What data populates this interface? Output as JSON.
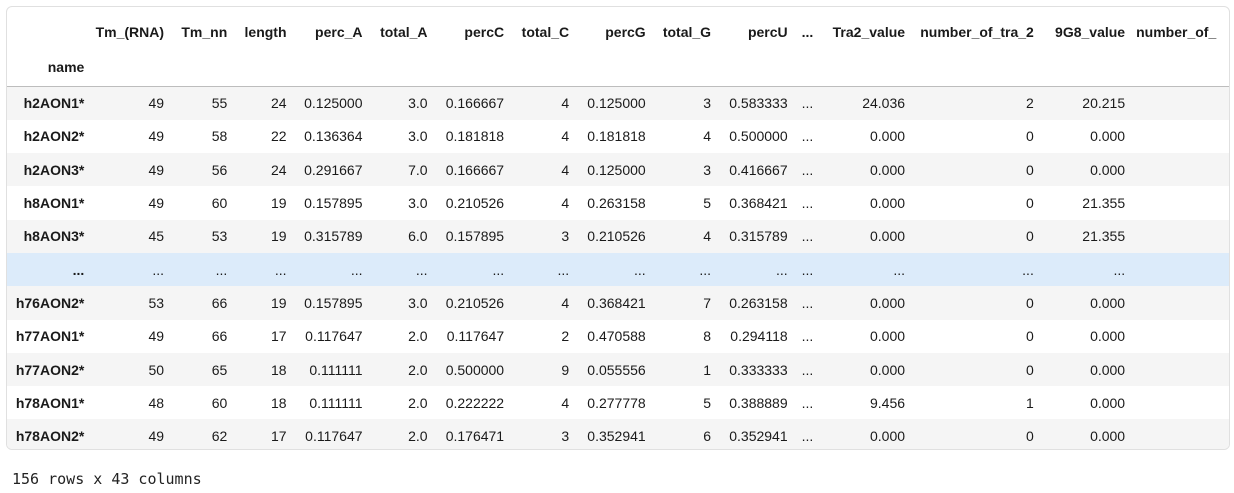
{
  "table": {
    "columns": [
      "Tm_(RNA)",
      "Tm_nn",
      "length",
      "perc_A",
      "total_A",
      "percC",
      "total_C",
      "percG",
      "total_G",
      "percU",
      "...",
      "Tra2_value",
      "number_of_tra_2",
      "9G8_value",
      "number_of_"
    ],
    "index_name": "name",
    "rows": [
      {
        "name": "h2AON1*",
        "cells": [
          "49",
          "55",
          "24",
          "0.125000",
          "3.0",
          "0.166667",
          "4",
          "0.125000",
          "3",
          "0.583333",
          "...",
          "24.036",
          "2",
          "20.215",
          ""
        ]
      },
      {
        "name": "h2AON2*",
        "cells": [
          "49",
          "58",
          "22",
          "0.136364",
          "3.0",
          "0.181818",
          "4",
          "0.181818",
          "4",
          "0.500000",
          "...",
          "0.000",
          "0",
          "0.000",
          ""
        ]
      },
      {
        "name": "h2AON3*",
        "cells": [
          "49",
          "56",
          "24",
          "0.291667",
          "7.0",
          "0.166667",
          "4",
          "0.125000",
          "3",
          "0.416667",
          "...",
          "0.000",
          "0",
          "0.000",
          ""
        ]
      },
      {
        "name": "h8AON1*",
        "cells": [
          "49",
          "60",
          "19",
          "0.157895",
          "3.0",
          "0.210526",
          "4",
          "0.263158",
          "5",
          "0.368421",
          "...",
          "0.000",
          "0",
          "21.355",
          ""
        ]
      },
      {
        "name": "h8AON3*",
        "cells": [
          "45",
          "53",
          "19",
          "0.315789",
          "6.0",
          "0.157895",
          "3",
          "0.210526",
          "4",
          "0.315789",
          "...",
          "0.000",
          "0",
          "21.355",
          ""
        ]
      },
      {
        "name": "...",
        "cells": [
          "...",
          "...",
          "...",
          "...",
          "...",
          "...",
          "...",
          "...",
          "...",
          "...",
          "...",
          "...",
          "...",
          "...",
          ""
        ]
      },
      {
        "name": "h76AON2*",
        "cells": [
          "53",
          "66",
          "19",
          "0.157895",
          "3.0",
          "0.210526",
          "4",
          "0.368421",
          "7",
          "0.263158",
          "...",
          "0.000",
          "0",
          "0.000",
          ""
        ]
      },
      {
        "name": "h77AON1*",
        "cells": [
          "49",
          "66",
          "17",
          "0.117647",
          "2.0",
          "0.117647",
          "2",
          "0.470588",
          "8",
          "0.294118",
          "...",
          "0.000",
          "0",
          "0.000",
          ""
        ]
      },
      {
        "name": "h77AON2*",
        "cells": [
          "50",
          "65",
          "18",
          "0.111111",
          "2.0",
          "0.500000",
          "9",
          "0.055556",
          "1",
          "0.333333",
          "...",
          "0.000",
          "0",
          "0.000",
          ""
        ]
      },
      {
        "name": "h78AON1*",
        "cells": [
          "48",
          "60",
          "18",
          "0.111111",
          "2.0",
          "0.222222",
          "4",
          "0.277778",
          "5",
          "0.388889",
          "...",
          "9.456",
          "1",
          "0.000",
          ""
        ]
      },
      {
        "name": "h78AON2*",
        "cells": [
          "49",
          "62",
          "17",
          "0.117647",
          "2.0",
          "0.176471",
          "3",
          "0.352941",
          "6",
          "0.352941",
          "...",
          "0.000",
          "0",
          "0.000",
          ""
        ]
      }
    ]
  },
  "footer": {
    "shape_text": "156 rows x 43 columns"
  },
  "colors": {
    "odd_row": "#f5f5f5",
    "highlight_row": "#dcebfa",
    "border": "#e0e0e0"
  }
}
